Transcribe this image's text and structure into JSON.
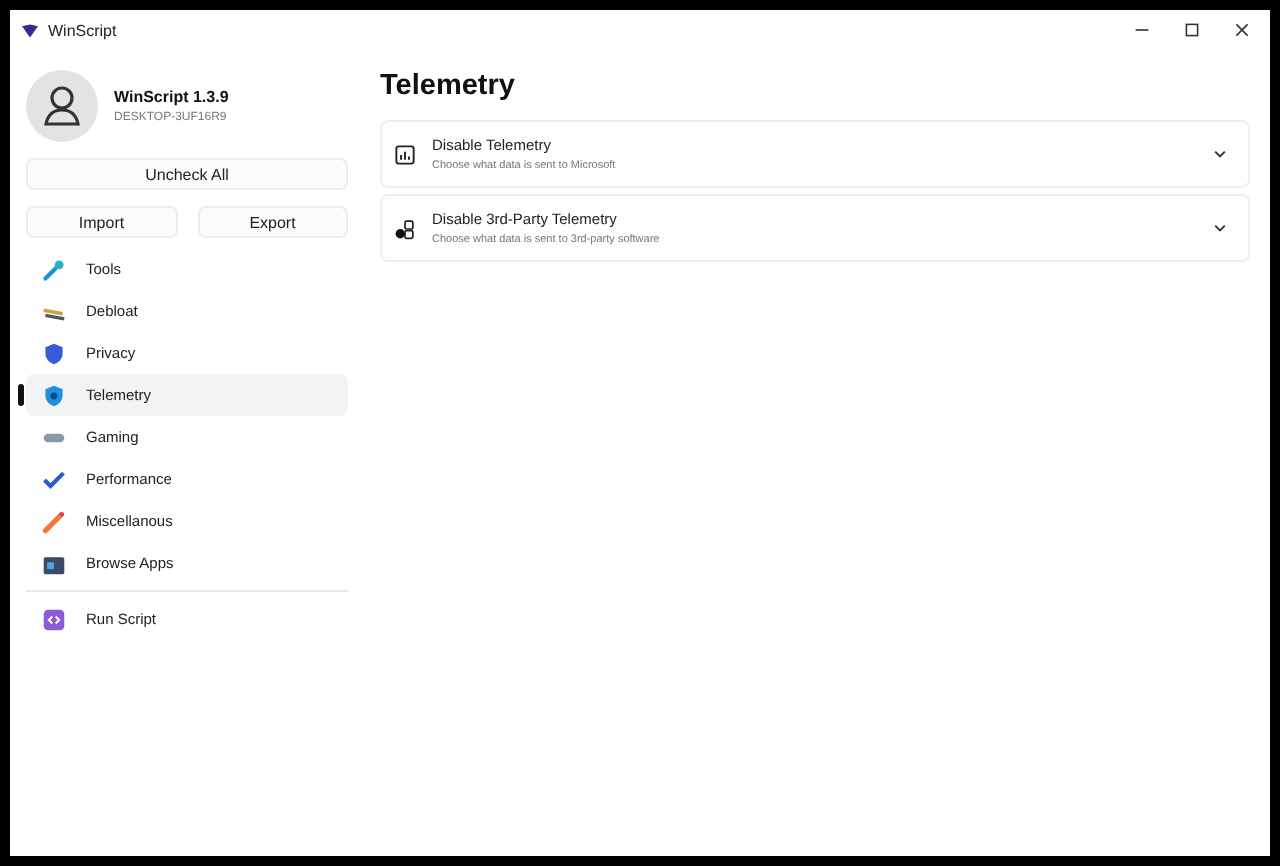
{
  "window": {
    "title": "WinScript"
  },
  "profile": {
    "name": "WinScript 1.3.9",
    "device": "DESKTOP-3UF16R9"
  },
  "buttons": {
    "uncheck_all": "Uncheck All",
    "import": "Import",
    "export": "Export"
  },
  "nav": [
    {
      "label": "Tools",
      "kind": "tools",
      "selected": false
    },
    {
      "label": "Debloat",
      "kind": "debloat",
      "selected": false
    },
    {
      "label": "Privacy",
      "kind": "privacy",
      "selected": false
    },
    {
      "label": "Telemetry",
      "kind": "telemetry",
      "selected": true
    },
    {
      "label": "Gaming",
      "kind": "gaming",
      "selected": false
    },
    {
      "label": "Performance",
      "kind": "performance",
      "selected": false
    },
    {
      "label": "Miscellanous",
      "kind": "misc",
      "selected": false
    },
    {
      "label": "Browse Apps",
      "kind": "apps",
      "selected": false
    }
  ],
  "run": {
    "label": "Run Script"
  },
  "page": {
    "title": "Telemetry"
  },
  "options": [
    {
      "title": "Disable Telemetry",
      "description": "Choose what data is sent to Microsoft",
      "kind": "chart",
      "expanded": false
    },
    {
      "title": "Disable 3rd-Party Telemetry",
      "description": "Choose what data is sent to 3rd-party software",
      "kind": "apps",
      "expanded": false
    }
  ]
}
